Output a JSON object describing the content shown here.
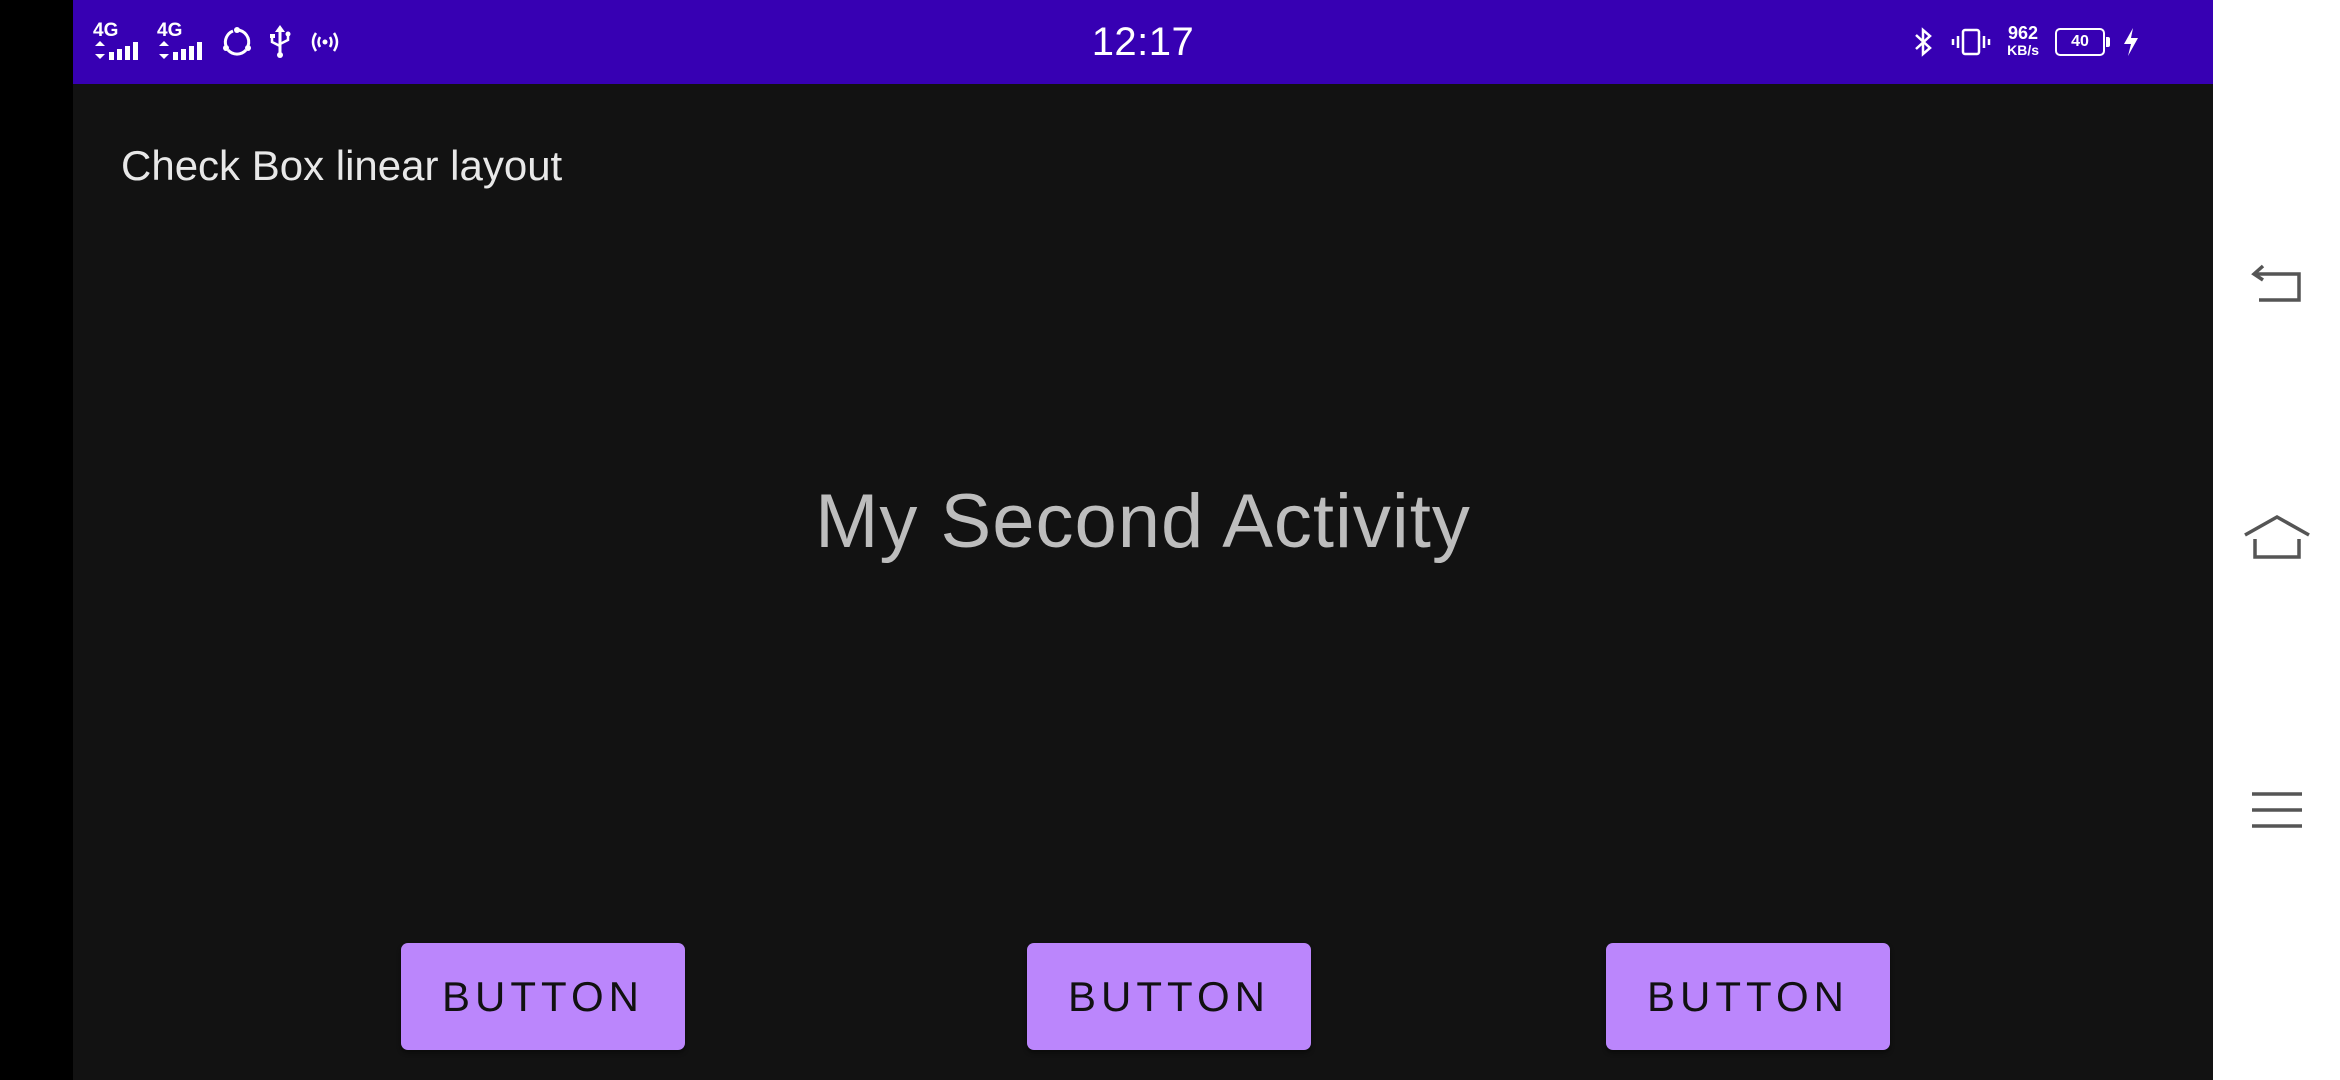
{
  "status_bar": {
    "time": "12:17",
    "signal_1_label": "4G",
    "signal_2_label": "4G",
    "net_speed_value": "962",
    "net_speed_unit": "KB/s",
    "battery_level": "40",
    "icons": [
      "signal-icon",
      "signal-icon",
      "sync-icon",
      "usb-icon",
      "hotspot-icon",
      "bluetooth-icon",
      "vibrate-icon",
      "battery-icon",
      "charging-icon"
    ],
    "background": "#3700B3"
  },
  "app": {
    "title": "Check Box linear layout",
    "main_text": "My Second Activity",
    "background": "#121212"
  },
  "buttons": [
    {
      "label": "BUTTON"
    },
    {
      "label": "BUTTON"
    },
    {
      "label": "BUTTON"
    }
  ],
  "button_color": "#BB86FC",
  "nav_bar": {
    "items": [
      "back-icon",
      "home-icon",
      "menu-icon"
    ]
  }
}
